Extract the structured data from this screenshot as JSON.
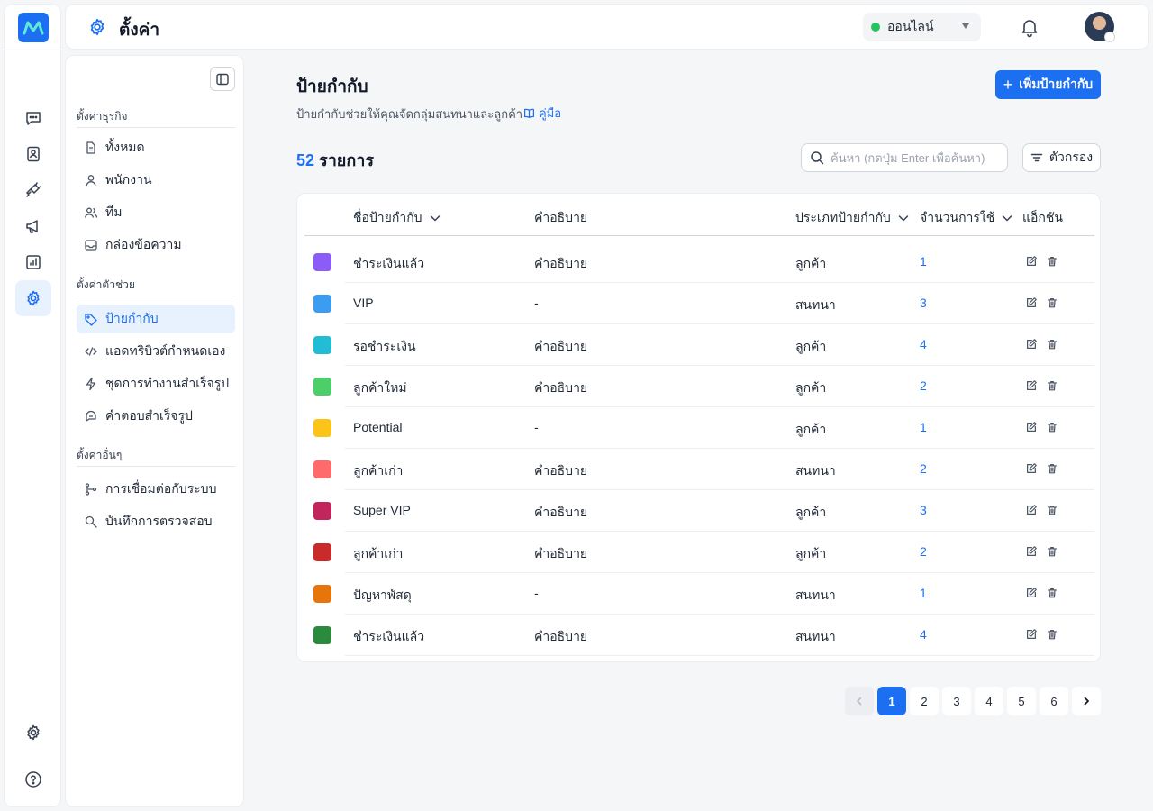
{
  "header": {
    "title": "ตั้งค่า",
    "status": "ออนไลน์"
  },
  "sidebar": {
    "sections": [
      {
        "label": "ตั้งค่าธุรกิจ",
        "items": [
          {
            "label": "ทั้งหมด",
            "icon": "document-icon"
          },
          {
            "label": "พนักงาน",
            "icon": "user-icon"
          },
          {
            "label": "ทีม",
            "icon": "users-icon"
          },
          {
            "label": "กล่องข้อความ",
            "icon": "inbox-icon"
          }
        ]
      },
      {
        "label": "ตั้งค่าตัวช่วย",
        "items": [
          {
            "label": "ป้ายกำกับ",
            "icon": "tag-icon",
            "active": true
          },
          {
            "label": "แอดทริบิวต์กำหนดเอง",
            "icon": "code-icon"
          },
          {
            "label": "ชุดการทำงานสำเร็จรูป",
            "icon": "lightning-icon"
          },
          {
            "label": "คำตอบสำเร็จรูป",
            "icon": "chat-bubble-icon"
          }
        ]
      },
      {
        "label": "ตั้งค่าอื่นๆ",
        "items": [
          {
            "label": "การเชื่อมต่อกับระบบ",
            "icon": "integration-icon"
          },
          {
            "label": "บันทึกการตรวจสอบ",
            "icon": "audit-search-icon"
          }
        ]
      }
    ]
  },
  "main": {
    "title": "ป้ายกำกับ",
    "subtitle": "ป้ายกำกับช่วยให้คุณจัดกลุ่มสนทนาและลูกค้า",
    "guide_link": "คู่มือ",
    "add_button": "เพิ่มป้ายกำกับ",
    "count_number": "52",
    "count_label": "รายการ",
    "search_placeholder": "ค้นหา (กดปุ่ม Enter เพื่อค้นหา)",
    "filter_button": "ตัวกรอง"
  },
  "table": {
    "columns": {
      "name": "ชื่อป้ายกำกับ",
      "description": "คำอธิบาย",
      "type": "ประเภทป้ายกำกับ",
      "usage": "จำนวนการใช้",
      "actions": "แอ็กชัน"
    },
    "rows": [
      {
        "color": "#8b5cf6",
        "name": "ชำระเงินแล้ว",
        "description": "คำอธิบาย",
        "type": "ลูกค้า",
        "usage": "1"
      },
      {
        "color": "#3b9cf0",
        "name": "VIP",
        "description": "-",
        "type": "สนทนา",
        "usage": "3"
      },
      {
        "color": "#22bcd4",
        "name": "รอชำระเงิน",
        "description": "คำอธิบาย",
        "type": "ลูกค้า",
        "usage": "4"
      },
      {
        "color": "#4ccf68",
        "name": "ลูกค้าใหม่",
        "description": "คำอธิบาย",
        "type": "ลูกค้า",
        "usage": "2"
      },
      {
        "color": "#fcc419",
        "name": "Potential",
        "description": "-",
        "type": "ลูกค้า",
        "usage": "1"
      },
      {
        "color": "#ff6b6b",
        "name": "ลูกค้าเก่า",
        "description": "คำอธิบาย",
        "type": "สนทนา",
        "usage": "2"
      },
      {
        "color": "#c2255c",
        "name": "Super VIP",
        "description": "คำอธิบาย",
        "type": "ลูกค้า",
        "usage": "3"
      },
      {
        "color": "#c92a2a",
        "name": "ลูกค้าเก่า",
        "description": "คำอธิบาย",
        "type": "ลูกค้า",
        "usage": "2"
      },
      {
        "color": "#e8750c",
        "name": "ปัญหาพัสดุ",
        "description": "-",
        "type": "สนทนา",
        "usage": "1"
      },
      {
        "color": "#2b8a3e",
        "name": "ชำระเงินแล้ว",
        "description": "คำอธิบาย",
        "type": "สนทนา",
        "usage": "4"
      }
    ]
  },
  "pagination": {
    "pages": [
      "1",
      "2",
      "3",
      "4",
      "5",
      "6"
    ],
    "current": "1"
  },
  "colors": {
    "accent": "#1d6ff2",
    "online": "#22c55e"
  }
}
